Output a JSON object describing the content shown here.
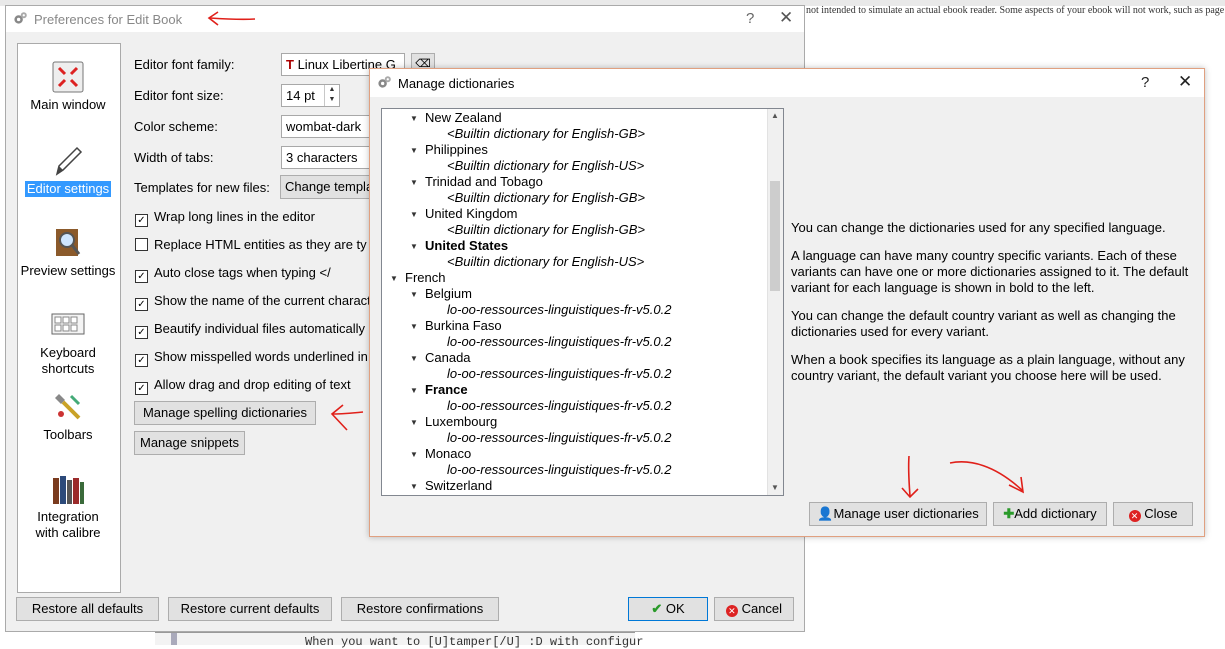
{
  "background": {
    "note": "not intended to simulate an actual ebook reader. Some aspects of your ebook will not work, such as page breaks",
    "code_snippet": "When you want to [U]tamper[/U] :D with configur"
  },
  "prefs": {
    "title": "Preferences for Edit Book",
    "help": "?",
    "close": "✕",
    "sidebar": [
      {
        "name": "main-window",
        "label": "Main window",
        "icon": "main-window-icon"
      },
      {
        "name": "editor-settings",
        "label": "Editor settings",
        "icon": "pen-icon",
        "selected": true
      },
      {
        "name": "preview-settings",
        "label": "Preview settings",
        "icon": "magnifier-icon"
      },
      {
        "name": "keyboard-shortcuts",
        "label": "Keyboard shortcuts",
        "icon": "keyboard-icon"
      },
      {
        "name": "toolbars",
        "label": "Toolbars",
        "icon": "toolbars-icon"
      },
      {
        "name": "integration",
        "label": "Integration with calibre",
        "icon": "books-icon"
      }
    ],
    "font_family_label": "Editor font family:",
    "font_family_value": "Linux Libertine G",
    "font_size_label": "Editor font size:",
    "font_size_value": "14 pt",
    "color_scheme_label": "Color scheme:",
    "color_scheme_value": "wombat-dark",
    "tabs_label": "Width of tabs:",
    "tabs_value": "3 characters",
    "templates_label": "Templates for new files:",
    "templates_button": "Change templa",
    "checks": [
      {
        "label": "Wrap long lines in the editor",
        "checked": true
      },
      {
        "label": "Replace HTML entities as they are ty",
        "checked": false
      },
      {
        "label": "Auto close tags when typing </",
        "checked": true
      },
      {
        "label": "Show the name of the current charact",
        "checked": true
      },
      {
        "label": "Beautify individual files automatically",
        "checked": true
      },
      {
        "label": "Show misspelled words underlined in",
        "checked": true
      },
      {
        "label": "Allow drag and drop editing of text",
        "checked": true
      }
    ],
    "manage_spelling": "Manage spelling dictionaries",
    "manage_snippets": "Manage snippets",
    "restore_all": "Restore all defaults",
    "restore_current": "Restore current defaults",
    "restore_confirmations": "Restore confirmations",
    "ok": "OK",
    "cancel": "Cancel"
  },
  "dialog": {
    "title": "Manage dictionaries",
    "help": "?",
    "close": "✕",
    "tree": [
      {
        "text": "New Zealand",
        "level": 1,
        "arrow": true
      },
      {
        "text": "<Builtin dictionary for English-GB>",
        "level": 2,
        "dict": true
      },
      {
        "text": "Philippines",
        "level": 1,
        "arrow": true
      },
      {
        "text": "<Builtin dictionary for English-US>",
        "level": 2,
        "dict": true
      },
      {
        "text": "Trinidad and Tobago",
        "level": 1,
        "arrow": true
      },
      {
        "text": "<Builtin dictionary for English-GB>",
        "level": 2,
        "dict": true
      },
      {
        "text": "United Kingdom",
        "level": 1,
        "arrow": true
      },
      {
        "text": "<Builtin dictionary for English-GB>",
        "level": 2,
        "dict": true
      },
      {
        "text": "United States",
        "level": 1,
        "arrow": true,
        "bold": true
      },
      {
        "text": "<Builtin dictionary for English-US>",
        "level": 2,
        "dict": true
      },
      {
        "text": "French",
        "level": 0,
        "arrow": true
      },
      {
        "text": "Belgium",
        "level": 1,
        "arrow": true
      },
      {
        "text": "lo-oo-ressources-linguistiques-fr-v5.0.2",
        "level": 2,
        "dict": true
      },
      {
        "text": "Burkina Faso",
        "level": 1,
        "arrow": true
      },
      {
        "text": "lo-oo-ressources-linguistiques-fr-v5.0.2",
        "level": 2,
        "dict": true
      },
      {
        "text": "Canada",
        "level": 1,
        "arrow": true
      },
      {
        "text": "lo-oo-ressources-linguistiques-fr-v5.0.2",
        "level": 2,
        "dict": true
      },
      {
        "text": "France",
        "level": 1,
        "arrow": true,
        "bold": true
      },
      {
        "text": "lo-oo-ressources-linguistiques-fr-v5.0.2",
        "level": 2,
        "dict": true
      },
      {
        "text": "Luxembourg",
        "level": 1,
        "arrow": true
      },
      {
        "text": "lo-oo-ressources-linguistiques-fr-v5.0.2",
        "level": 2,
        "dict": true
      },
      {
        "text": "Monaco",
        "level": 1,
        "arrow": true
      },
      {
        "text": "lo-oo-ressources-linguistiques-fr-v5.0.2",
        "level": 2,
        "dict": true
      },
      {
        "text": "Switzerland",
        "level": 1,
        "arrow": true
      }
    ],
    "info": [
      "You can change the dictionaries used for any specified language.",
      "A language can have many country specific variants. Each of these variants can have one or more dictionaries assigned to it. The default variant for each language is shown in bold to the left.",
      "You can change the default country variant as well as changing the dictionaries used for every variant.",
      "When a book specifies its language as a plain language, without any country variant, the default variant you choose here will be used."
    ],
    "manage_user": "Manage user dictionaries",
    "add_dict": "Add dictionary",
    "close_button": "Close"
  },
  "colors": {
    "selection": "#3399ff",
    "annotation": "#e0201a"
  }
}
